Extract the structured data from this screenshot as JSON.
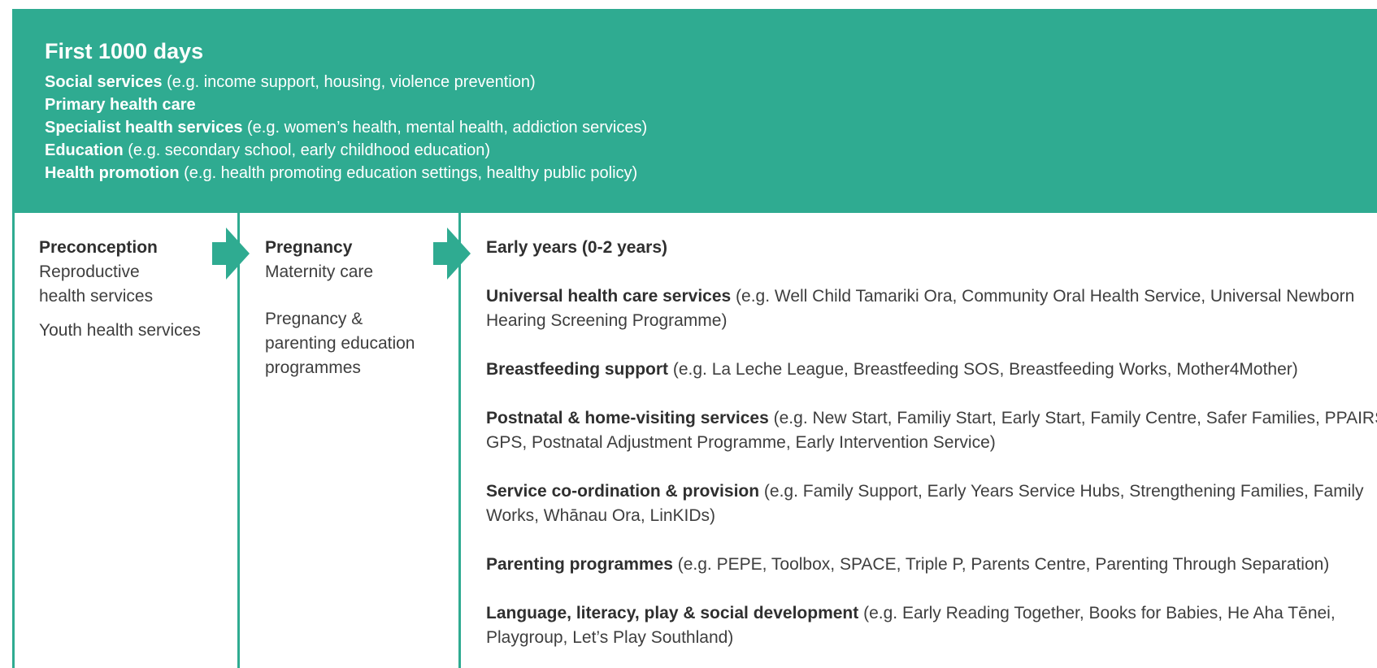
{
  "banner": {
    "title": "First 1000 days",
    "lines": [
      {
        "bold": "Social services",
        "rest": " (e.g. income support, housing, violence prevention)"
      },
      {
        "bold": "Primary health care",
        "rest": ""
      },
      {
        "bold": "Specialist health services",
        "rest": " (e.g. women’s health, mental health, addiction services)"
      },
      {
        "bold": "Education",
        "rest": " (e.g. secondary school, early childhood education)"
      },
      {
        "bold": "Health promotion",
        "rest": " (e.g. health promoting education settings, healthy public policy)"
      }
    ]
  },
  "preconception": {
    "heading": "Preconception",
    "item1_line1": "Reproductive",
    "item1_line2": "health services",
    "item2": "Youth health services"
  },
  "pregnancy": {
    "heading": "Pregnancy",
    "item1": "Maternity care",
    "item2_line1": "Pregnancy &",
    "item2_line2": "parenting education",
    "item2_line3": "programmes"
  },
  "early_years": {
    "heading": "Early years (0-2 years)",
    "items": [
      {
        "bold": "Universal health care services",
        "rest": " (e.g. Well Child Tamariki Ora, Community Oral Health Service, Universal Newborn Hearing Screening Programme)"
      },
      {
        "bold": "Breastfeeding support",
        "rest": " (e.g. La Leche League, Breastfeeding SOS, Breastfeeding Works, Mother4Mother)"
      },
      {
        "bold": "Postnatal & home-visiting services",
        "rest": " (e.g. New Start, Familiy Start, Early Start, Family Centre, Safer Families, PPAIRS, GPS, Postnatal Adjustment Programme, Early Intervention Service)"
      },
      {
        "bold": "Service co-ordination & provision",
        "rest": " (e.g. Family Support, Early Years Service Hubs, Strengthening Families, Family Works, Whānau Ora, LinKIDs)"
      },
      {
        "bold": "Parenting programmes",
        "rest": " (e.g. PEPE, Toolbox, SPACE, Triple P, Parents Centre, Parenting Through Separation)"
      },
      {
        "bold": "Language, literacy, play & social development",
        "rest": " (e.g. Early Reading Together, Books for Babies, He Aha Tēnei, Playgroup, Let’s Play Southland)"
      }
    ]
  },
  "colors": {
    "accent": "#2fab91"
  },
  "icons": {
    "arrow1": "right-arrow-icon",
    "arrow2": "right-arrow-icon"
  }
}
